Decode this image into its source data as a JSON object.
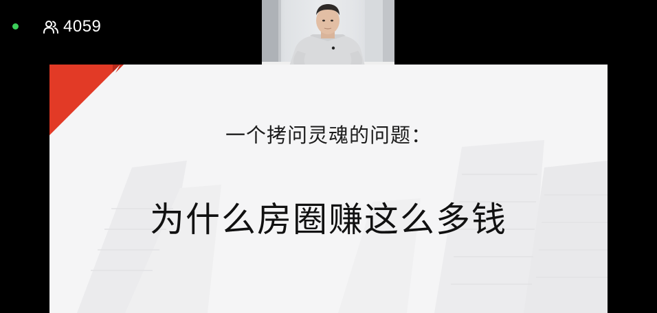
{
  "stream": {
    "live_indicator_color": "#3ccf5a",
    "viewers_icon": "people-icon",
    "viewer_count": "4059"
  },
  "webcam": {
    "content": "presenter-video-feed"
  },
  "slide": {
    "accent_color": "#e23a26",
    "question": "一个拷问灵魂的问题：",
    "headline": "为什么房圈赚这么多钱"
  }
}
